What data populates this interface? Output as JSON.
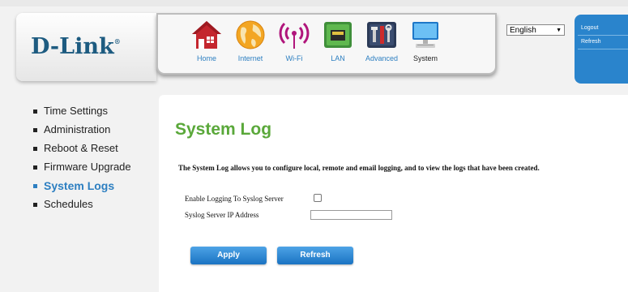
{
  "brand": {
    "logo": "D-Link",
    "reg_mark": "®"
  },
  "nav": {
    "items": [
      {
        "label": "Home",
        "icon": "house-icon"
      },
      {
        "label": "Internet",
        "icon": "globe-icon"
      },
      {
        "label": "Wi-Fi",
        "icon": "wifi-icon"
      },
      {
        "label": "LAN",
        "icon": "lan-port-icon"
      },
      {
        "label": "Advanced",
        "icon": "tools-icon"
      },
      {
        "label": "System",
        "icon": "computer-icon"
      }
    ]
  },
  "language": {
    "selected": "English"
  },
  "side_panel": {
    "logout": "Logout",
    "refresh": "Refresh"
  },
  "menu": {
    "items": [
      {
        "label": "Time Settings"
      },
      {
        "label": "Administration"
      },
      {
        "label": "Reboot & Reset"
      },
      {
        "label": "Firmware Upgrade"
      },
      {
        "label": "System Logs",
        "active": true
      },
      {
        "label": "Schedules"
      }
    ]
  },
  "page": {
    "title": "System Log",
    "description": "The System Log allows you to configure local, remote and email logging, and to view the logs that have been created.",
    "enable_logging_label": "Enable Logging To Syslog Server",
    "ip_label": "Syslog Server IP Address",
    "ip_value": "",
    "apply": "Apply",
    "refresh": "Refresh"
  },
  "colors": {
    "brand_blue": "#1d5b80",
    "accent_blue": "#2d7fc1",
    "title_green": "#5aa83a",
    "button_blue": "#1a73c2"
  }
}
